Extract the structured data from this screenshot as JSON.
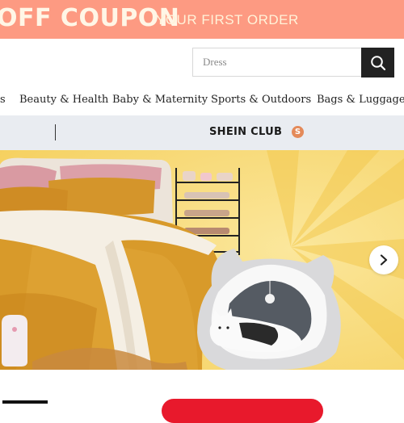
{
  "promo": {
    "main_text": "OFF COUPON",
    "sub_text": "YOUR FIRST ORDER"
  },
  "search": {
    "placeholder": "Dress",
    "button_icon": "search-icon"
  },
  "categories": [
    "s",
    "Beauty & Health",
    "Baby & Maternity",
    "Sports & Outdoors",
    "Bags & Luggage"
  ],
  "club": {
    "label": "SHEIN CLUB",
    "badge": "S"
  },
  "hero": {
    "next_icon": "chevron-right-icon"
  },
  "colors": {
    "promo_bg": "#fd9a82",
    "promo_text": "#fff6e6",
    "search_button": "#222222",
    "club_bar": "#e9ecf1",
    "club_badge": "#e48a5a",
    "hero_bg": "#f7d978",
    "cta_red": "#e8192c"
  }
}
